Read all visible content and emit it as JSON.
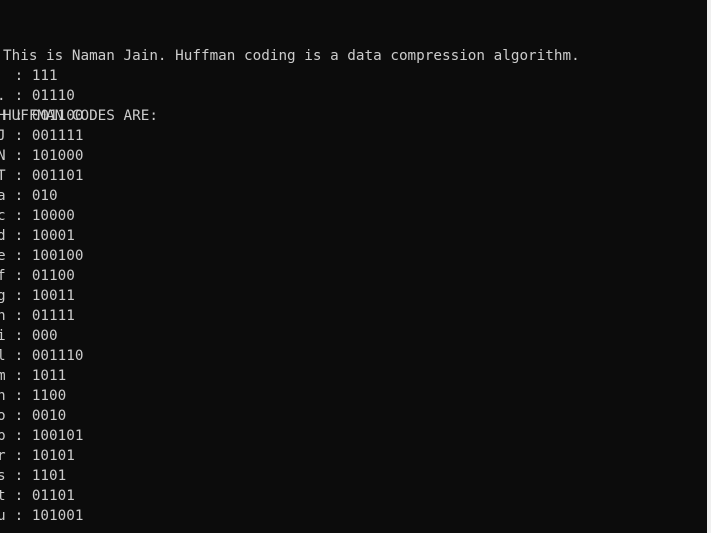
{
  "console": {
    "intro_line": "This is Naman Jain. Huffman coding is a data compression algorithm.",
    "header_line": "HUFFMAN CODES ARE:",
    "separator": " : ",
    "codes": [
      {
        "symbol": " ",
        "code": "111"
      },
      {
        "symbol": ".",
        "code": "01110"
      },
      {
        "symbol": "H",
        "code": "001100"
      },
      {
        "symbol": "J",
        "code": "001111"
      },
      {
        "symbol": "N",
        "code": "101000"
      },
      {
        "symbol": "T",
        "code": "001101"
      },
      {
        "symbol": "a",
        "code": "010"
      },
      {
        "symbol": "c",
        "code": "10000"
      },
      {
        "symbol": "d",
        "code": "10001"
      },
      {
        "symbol": "e",
        "code": "100100"
      },
      {
        "symbol": "f",
        "code": "01100"
      },
      {
        "symbol": "g",
        "code": "10011"
      },
      {
        "symbol": "h",
        "code": "01111"
      },
      {
        "symbol": "i",
        "code": "000"
      },
      {
        "symbol": "l",
        "code": "001110"
      },
      {
        "symbol": "m",
        "code": "1011"
      },
      {
        "symbol": "n",
        "code": "1100"
      },
      {
        "symbol": "o",
        "code": "0010"
      },
      {
        "symbol": "p",
        "code": "100101"
      },
      {
        "symbol": "r",
        "code": "10101"
      },
      {
        "symbol": "s",
        "code": "1101"
      },
      {
        "symbol": "t",
        "code": "01101"
      },
      {
        "symbol": "u",
        "code": "101001"
      }
    ]
  },
  "colors": {
    "background": "#0c0c0c",
    "text": "#cccccc"
  }
}
